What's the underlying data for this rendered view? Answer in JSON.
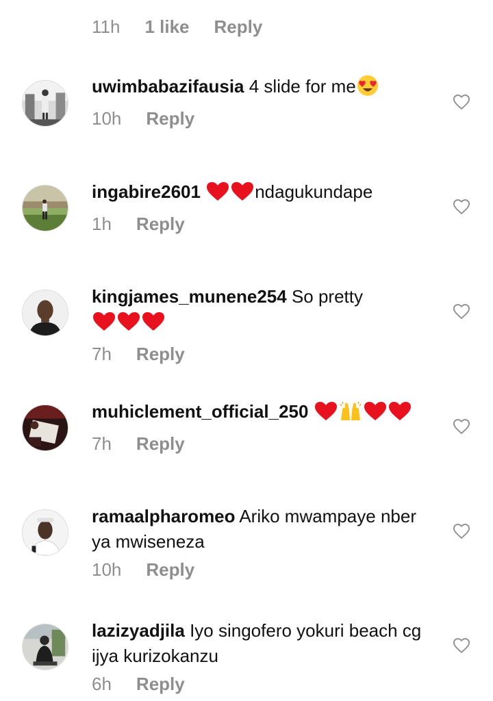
{
  "previous_comment_meta": {
    "time": "11h",
    "likes": "1 like",
    "reply": "Reply"
  },
  "comments": [
    {
      "username": "uwimbabazifausia",
      "text": "4 slide for me",
      "emojis_after": [
        "heart-eyes-emoji"
      ],
      "time": "10h",
      "reply": "Reply"
    },
    {
      "username": "ingabire2601",
      "emojis_before": [
        "red-heart-emoji",
        "red-heart-emoji"
      ],
      "text": "ndagukundape",
      "time": "1h",
      "reply": "Reply"
    },
    {
      "username": "kingjames_munene254",
      "text": "So pretty",
      "emojis_after": [
        "red-heart-emoji",
        "red-heart-emoji",
        "red-heart-emoji"
      ],
      "time": "7h",
      "reply": "Reply"
    },
    {
      "username": "muhiclement_official_250",
      "text": "",
      "emojis_after": [
        "red-heart-emoji",
        "raising-hands-emoji",
        "red-heart-emoji",
        "red-heart-emoji"
      ],
      "time": "7h",
      "reply": "Reply"
    },
    {
      "username": "ramaalpharomeo",
      "text": "Ariko mwampaye nber ya mwiseneza",
      "time": "10h",
      "reply": "Reply"
    },
    {
      "username": "lazizyadjila",
      "text": "Iyo singofero yokuri beach cg ijya kurizokanzu",
      "time": "6h",
      "reply": "Reply"
    }
  ],
  "icons": {
    "like": "heart-outline-icon"
  },
  "colors": {
    "text": "#111111",
    "muted": "#8e8e8e",
    "heart_red": "#ed1c24",
    "background": "#ffffff"
  }
}
